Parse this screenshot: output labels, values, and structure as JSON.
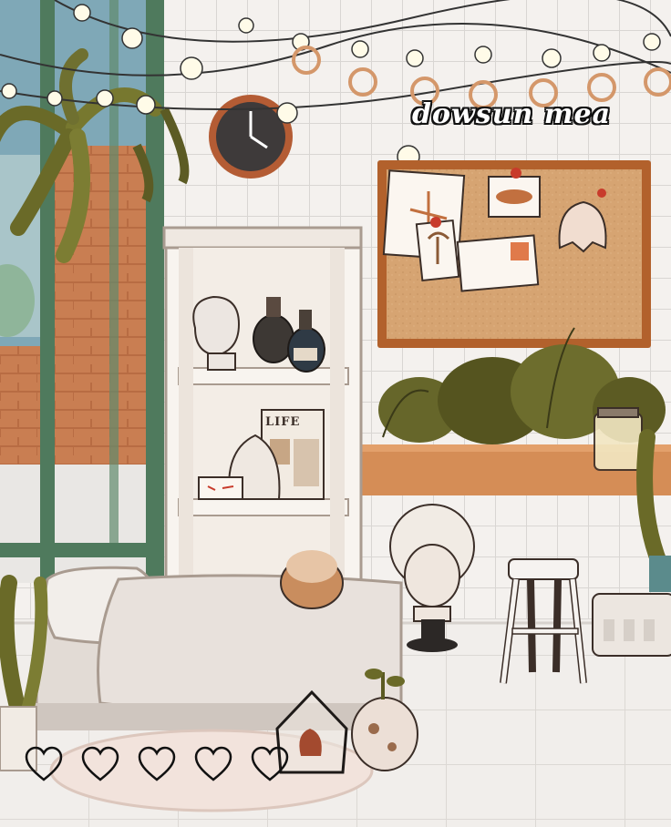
{
  "watermark": "dowsun mea",
  "magazine": {
    "title": "LIFE"
  },
  "hearts": [
    {
      "icon": "heart-outline-icon",
      "filled": false
    },
    {
      "icon": "heart-outline-icon",
      "filled": false
    },
    {
      "icon": "heart-outline-icon",
      "filled": false
    },
    {
      "icon": "heart-outline-icon",
      "filled": false
    },
    {
      "icon": "heart-outline-icon",
      "filled": false
    }
  ],
  "colors": {
    "wall_tile": "#f4f1ee",
    "grout": "#d9d6d3",
    "window_frame": "#4f7a5d",
    "brick": "#c57a4e",
    "cork": "#d3a06e",
    "cork_frame": "#b2612c",
    "shelf": "#f8f4ef",
    "plant": "#6c6a2b",
    "bed": "#e6e0db",
    "rug": "#f2e3dc"
  }
}
